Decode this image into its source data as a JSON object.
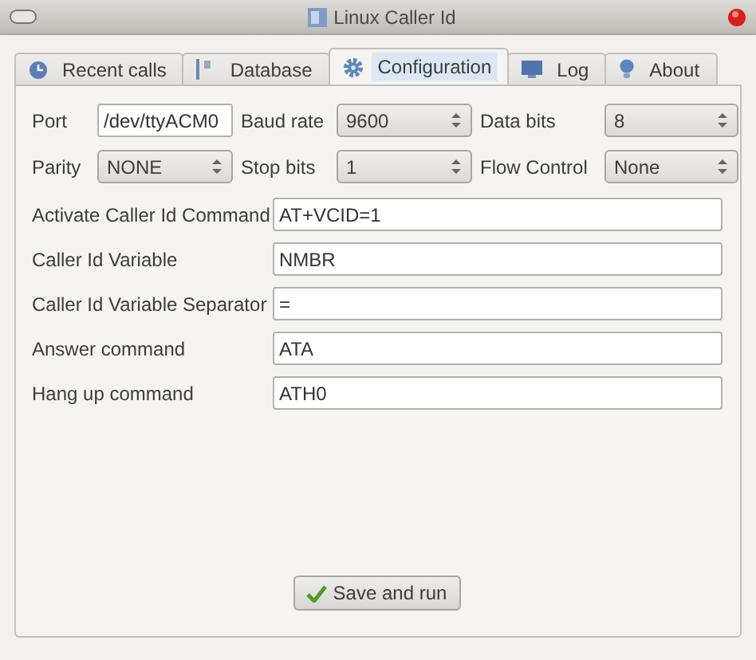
{
  "window": {
    "title": "Linux Caller Id"
  },
  "tabs": [
    {
      "label": "Recent calls",
      "selected": false
    },
    {
      "label": "Database",
      "selected": false
    },
    {
      "label": "Configuration",
      "selected": true
    },
    {
      "label": "Log",
      "selected": false
    },
    {
      "label": "About",
      "selected": false
    }
  ],
  "serial_settings": [
    {
      "label": "Port",
      "kind": "text",
      "value": "/dev/ttyACM0"
    },
    {
      "label": "Baud rate",
      "kind": "combo",
      "value": "9600"
    },
    {
      "label": "Data bits",
      "kind": "combo",
      "value": "8"
    },
    {
      "label": "Parity",
      "kind": "combo",
      "value": "NONE"
    },
    {
      "label": "Stop bits",
      "kind": "combo",
      "value": "1"
    },
    {
      "label": "Flow Control",
      "kind": "combo",
      "value": "None"
    }
  ],
  "commands": [
    {
      "label": "Activate Caller Id Command",
      "value": "AT+VCID=1"
    },
    {
      "label": "Caller Id Variable",
      "value": "NMBR"
    },
    {
      "label": "Caller Id Variable Separator",
      "value": "="
    },
    {
      "label": "Answer command",
      "value": "ATA"
    },
    {
      "label": "Hang up command",
      "value": "ATH0"
    }
  ],
  "save_button": {
    "label": "Save and run"
  }
}
